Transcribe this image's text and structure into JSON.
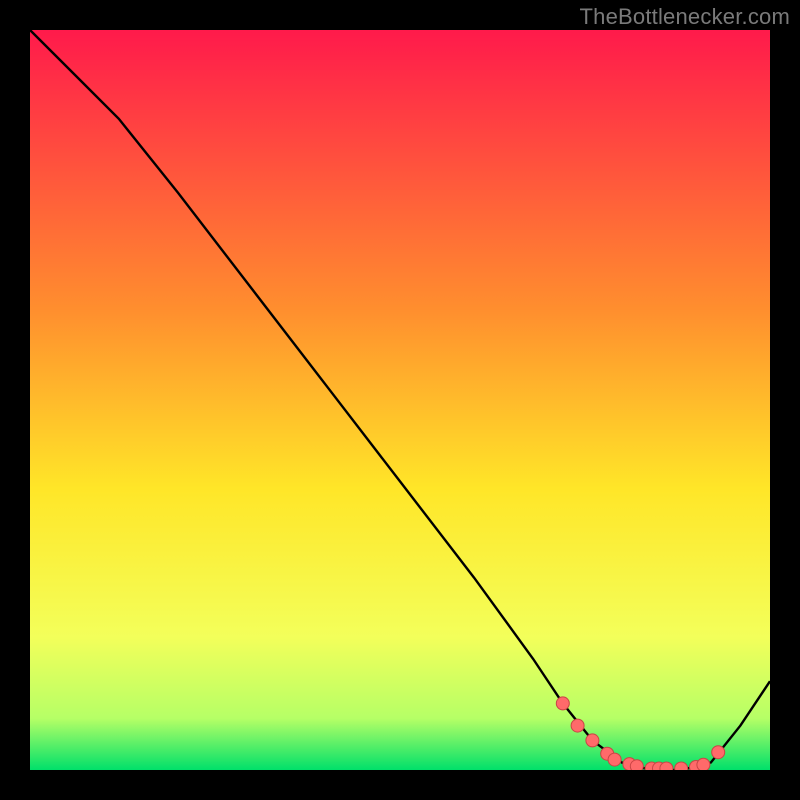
{
  "watermark": "TheBottlenecker.com",
  "colors": {
    "bg_black": "#000000",
    "grad_top": "#ff1a4b",
    "grad_mid_upper": "#ff8f2e",
    "grad_mid": "#ffe628",
    "grad_lower": "#f3ff5a",
    "grad_green_light": "#b6ff66",
    "grad_green": "#00e06a",
    "curve": "#000000",
    "marker_fill": "#ff6a6a",
    "marker_stroke": "#c94545"
  },
  "chart_data": {
    "type": "line",
    "title": "",
    "xlabel": "",
    "ylabel": "",
    "xlim": [
      0,
      100
    ],
    "ylim": [
      0,
      100
    ],
    "series": [
      {
        "name": "bottleneck-curve",
        "x": [
          0,
          6,
          12,
          20,
          30,
          40,
          50,
          60,
          68,
          72,
          76,
          80,
          84,
          88,
          92,
          96,
          100
        ],
        "y": [
          100,
          94,
          88,
          78,
          65,
          52,
          39,
          26,
          15,
          9,
          4,
          1,
          0,
          0,
          1,
          6,
          12
        ]
      }
    ],
    "markers": {
      "name": "highlight-points",
      "x": [
        72,
        74,
        76,
        78,
        79,
        81,
        82,
        84,
        85,
        86,
        88,
        90,
        91,
        93
      ],
      "y": [
        9,
        6,
        4,
        2.2,
        1.4,
        0.8,
        0.5,
        0.2,
        0.2,
        0.2,
        0.2,
        0.4,
        0.7,
        2.4
      ]
    }
  }
}
